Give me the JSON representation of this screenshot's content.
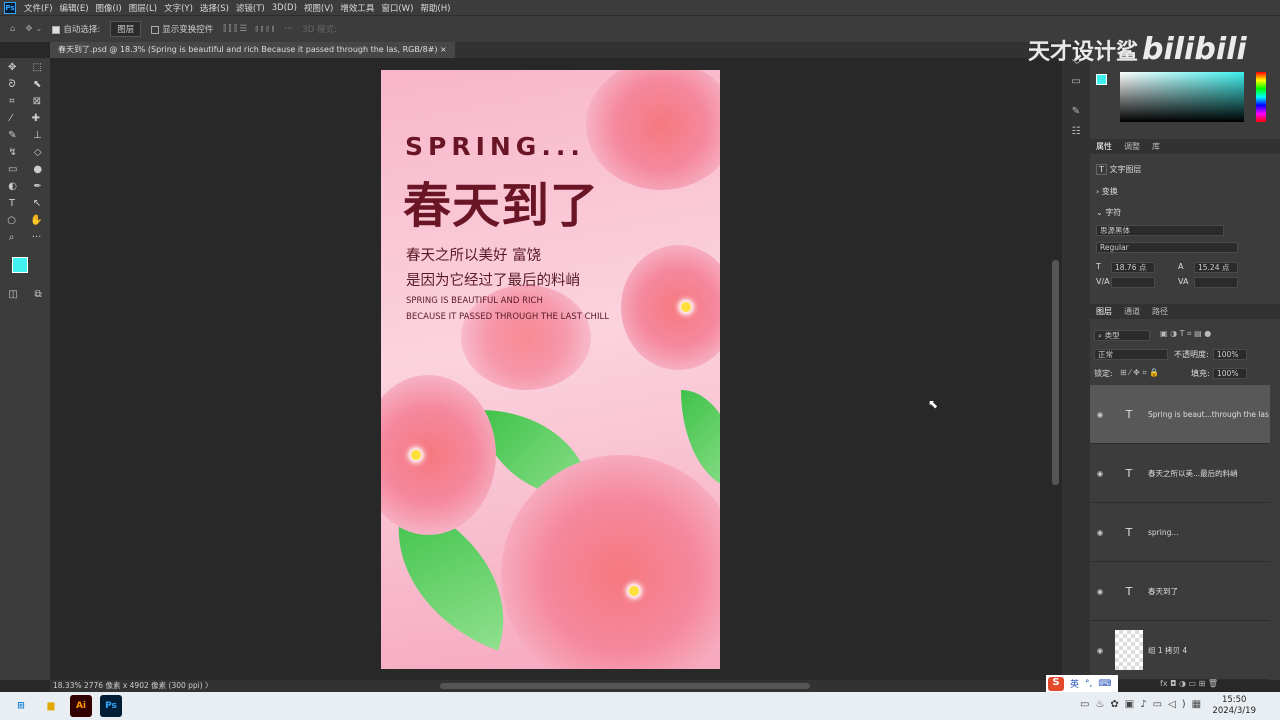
{
  "menu": [
    "文件(F)",
    "编辑(E)",
    "图像(I)",
    "图层(L)",
    "文字(Y)",
    "选择(S)",
    "滤镜(T)",
    "3D(D)",
    "视图(V)",
    "增效工具",
    "窗口(W)",
    "帮助(H)"
  ],
  "options": {
    "auto_select_label": "自动选择:",
    "auto_select_value": "图层",
    "show_transform_label": "显示变换控件",
    "mode_3d": "3D 模式:"
  },
  "tab": {
    "title": "春天到了.psd @ 18.3% (Spring is beautiful and rich  Because it passed through the las, RGB/8#)",
    "close": "×"
  },
  "poster": {
    "spring": "SPRING...",
    "title": "春天到了",
    "line1": "春天之所以美好 富饶",
    "line2": "是因为它经过了最后的料峭",
    "en1": "SPRING IS BEAUTIFUL AND RICH",
    "en2": "BECAUSE IT PASSED THROUGH THE LAST CHILL"
  },
  "watermark": {
    "text": "天才设计鲨",
    "logo": "bilibili"
  },
  "properties": {
    "tabs": [
      "属性",
      "调整",
      "库"
    ],
    "layer_type": "文字图层",
    "transform": "变换",
    "character": "字符",
    "font": "思源黑体",
    "style": "Regular",
    "size": "18.76 点",
    "leading": "15.24 点",
    "kerning_label": "V/A",
    "tracking_label": "VA"
  },
  "layers_panel": {
    "tabs": [
      "图层",
      "通道",
      "路径"
    ],
    "filter": "类型",
    "blend": "正常",
    "opacity_label": "不透明度:",
    "opacity": "100%",
    "lock_label": "锁定:",
    "fill_label": "填充:",
    "fill": "100%",
    "layers": [
      {
        "name": "Spring is beaut...through the las"
      },
      {
        "name": "春天之所以美...最后的料峭"
      },
      {
        "name": "spring..."
      },
      {
        "name": "春天到了"
      },
      {
        "name": "组 1 拷贝 4"
      }
    ]
  },
  "status": "18.33%  2776 像素 x 4902 像素 (300 ppi)  〉",
  "ime": {
    "lang": "英"
  },
  "clock": {
    "time": "15:50",
    "date": "2024/3/19"
  },
  "colors": {
    "foreground": "#3ff0ee",
    "accent": "#31a8ff"
  }
}
